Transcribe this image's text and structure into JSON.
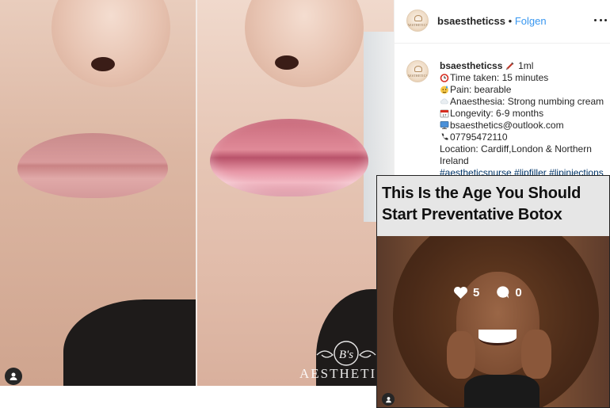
{
  "post": {
    "watermark_text": "AESTHETICS",
    "watermark_logo_initials": "B's"
  },
  "header": {
    "username": "bsaestheticss",
    "separator": "•",
    "follow_label": "Folgen",
    "avatar_text": "AESTHETICS"
  },
  "caption": {
    "username": "bsaestheticss",
    "volume": "1ml",
    "time_taken": "Time taken: 15 minutes",
    "pain": "Pain: bearable",
    "anaesthesia": "Anaesthesia: Strong numbing cream",
    "longevity": "Longevity: 6-9 months",
    "email": "bsaesthetics@outlook.com",
    "phone": "07795472110",
    "location": "Location: Cardiff,London & Northern Ireland",
    "hashtags": "#aestheticsnurse #lipfiller #lipinjections"
  },
  "overlay_card": {
    "title_line1": "This Is the Age You Should",
    "title_line2": "Start Preventative Botox",
    "likes": "5",
    "comments": "0"
  },
  "icons": [
    "user-icon",
    "more-options-icon",
    "syringe-icon",
    "alarm-clock-icon",
    "sweat-face-icon",
    "cloud-icon",
    "calendar-icon",
    "computer-icon",
    "telephone-icon",
    "heart-icon",
    "comment-icon"
  ],
  "colors": {
    "link_blue": "#3897f0",
    "hashtag_blue": "#003569",
    "text": "#262626",
    "card_bg": "#e6e6e6"
  }
}
